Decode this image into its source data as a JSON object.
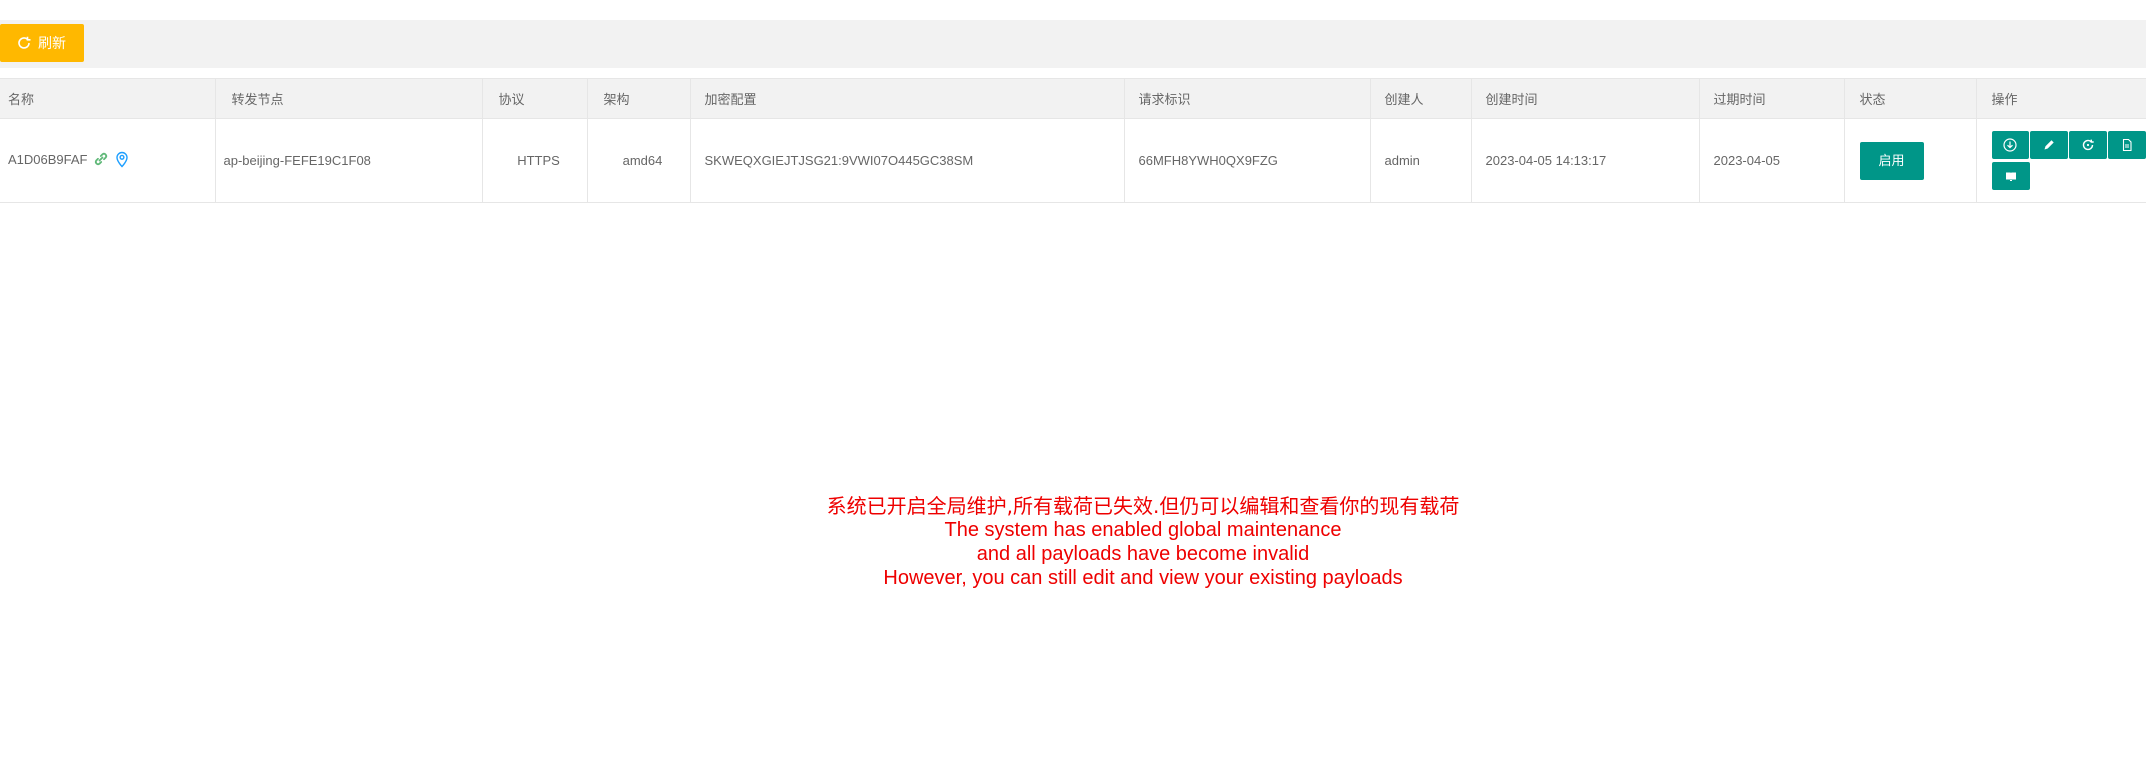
{
  "toolbar": {
    "refresh_label": "刷新",
    "refresh_color": "#FFB800"
  },
  "table": {
    "columns": [
      "名称",
      "转发节点",
      "协议",
      "架构",
      "加密配置",
      "请求标识",
      "创建人",
      "创建时间",
      "过期时间",
      "状态",
      "操作"
    ],
    "rows": [
      {
        "name": "A1D06B9FAF",
        "node": "ap-beijing-FEFE19C1F08",
        "protocol": "HTTPS",
        "arch": "amd64",
        "crypto": "SKWEQXGIEJTJSG21:9VWI07O445GC38SM",
        "request_id": "66MFH8YWH0QX9FZG",
        "creator": "admin",
        "created_at": "2023-04-05 14:13:17",
        "expires_at": "2023-04-05",
        "status": "启用",
        "icons": [
          "link-icon",
          "location-icon"
        ],
        "actions": [
          "download-icon",
          "edit-icon",
          "refresh-icon",
          "document-icon",
          "book-icon"
        ]
      }
    ],
    "accent_color": "#009688"
  },
  "notice": {
    "zh": "系统已开启全局维护,所有载荷已失效.但仍可以编辑和查看你的现有载荷",
    "en1": "The system has enabled global maintenance",
    "en2": "and all payloads have become invalid",
    "en3": "However, you can still edit and view your existing payloads",
    "color": "#ee0000"
  }
}
